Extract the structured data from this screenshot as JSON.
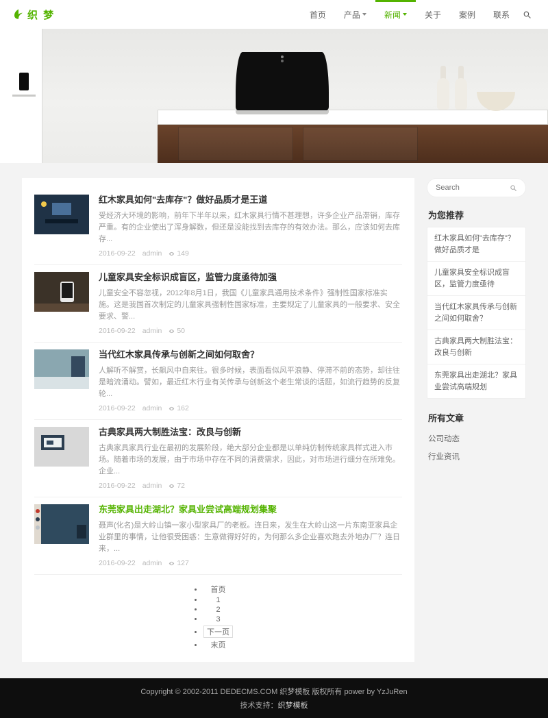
{
  "brand": {
    "text": "织 梦"
  },
  "nav": {
    "items": [
      {
        "label": "首页",
        "dropdown": false
      },
      {
        "label": "产品",
        "dropdown": true
      },
      {
        "label": "新闻",
        "dropdown": true,
        "active": true
      },
      {
        "label": "关于",
        "dropdown": false
      },
      {
        "label": "案例",
        "dropdown": false
      },
      {
        "label": "联系",
        "dropdown": false
      }
    ]
  },
  "search": {
    "placeholder": "Search"
  },
  "articles": [
    {
      "title": "红木家具如何\"去库存\"？做好品质才是王道",
      "summary": "受经济大环境的影响，前年下半年以来，红木家具行情不甚理想，许多企业产品滞销，库存严重。有的企业使出了浑身解数，但还是没能找到去库存的有效办法。那么，应该如何去库存...",
      "date": "2016-09-22",
      "author": "admin",
      "views": "149"
    },
    {
      "title": "儿童家具安全标识成盲区，监管力度亟待加强",
      "summary": "儿童安全不容忽视，2012年8月1日，我国《儿童家具通用技术条件》强制性国家标准实施。这是我国首次制定的儿童家具强制性国家标准，主要规定了儿童家具的一般要求、安全要求、警...",
      "date": "2016-09-22",
      "author": "admin",
      "views": "50"
    },
    {
      "title": "当代红木家具传承与创新之间如何取舍？",
      "summary": "人解听不解赏，长飙风中自来往。很多时候，表面看似风平浪静、停滞不前的态势，却往往是暗流涌动。譬如，最近红木行业有关传承与创新这个老生常谈的话题，如流行趋势的反复轮...",
      "date": "2016-09-22",
      "author": "admin",
      "views": "162"
    },
    {
      "title": "古典家具两大制胜法宝：改良与创新",
      "summary": "古典家具家具行业在最初的发展阶段，绝大部分企业都是以单纯仿制传统家具样式进入市场。随着市场的发展，由于市场中存在不同的消费需求，因此，对市场进行细分在所难免。企业...",
      "date": "2016-09-22",
      "author": "admin",
      "views": "72"
    },
    {
      "title": "东莞家具出走湖北？家具业尝试高端规划集聚",
      "summary": "聂声(化名)是大岭山镇一家小型家具厂的老板。连日来，发生在大岭山这一片东南亚家具企业群里的事情，让他很受困惑：生意做得好好的，为何那么多企业喜欢跑去外地办厂？连日来，...",
      "date": "2016-09-22",
      "author": "admin",
      "views": "127"
    }
  ],
  "pagination": {
    "home": "首页",
    "page1": "1",
    "page2": "2",
    "page3": "3",
    "next": "下一页",
    "last": "末页"
  },
  "sidebar": {
    "recommend_title": "为您推荐",
    "recommend": [
      "红木家具如何\"去库存\"？做好品质才是",
      "儿童家具安全标识成盲区，监管力度亟待",
      "当代红木家具传承与创新之间如何取舍？",
      "古典家具两大制胜法宝：改良与创新",
      "东莞家具出走湖北？家具业尝试高端规划"
    ],
    "cats_title": "所有文章",
    "cats": [
      "公司动态",
      "行业资讯"
    ]
  },
  "footer": {
    "line1": "Copyright © 2002-2011 DEDECMS.COM 织梦模板 版权所有 power by YzJuRen",
    "line2_prefix": "技术支持：",
    "line2_link": "织梦模板"
  }
}
